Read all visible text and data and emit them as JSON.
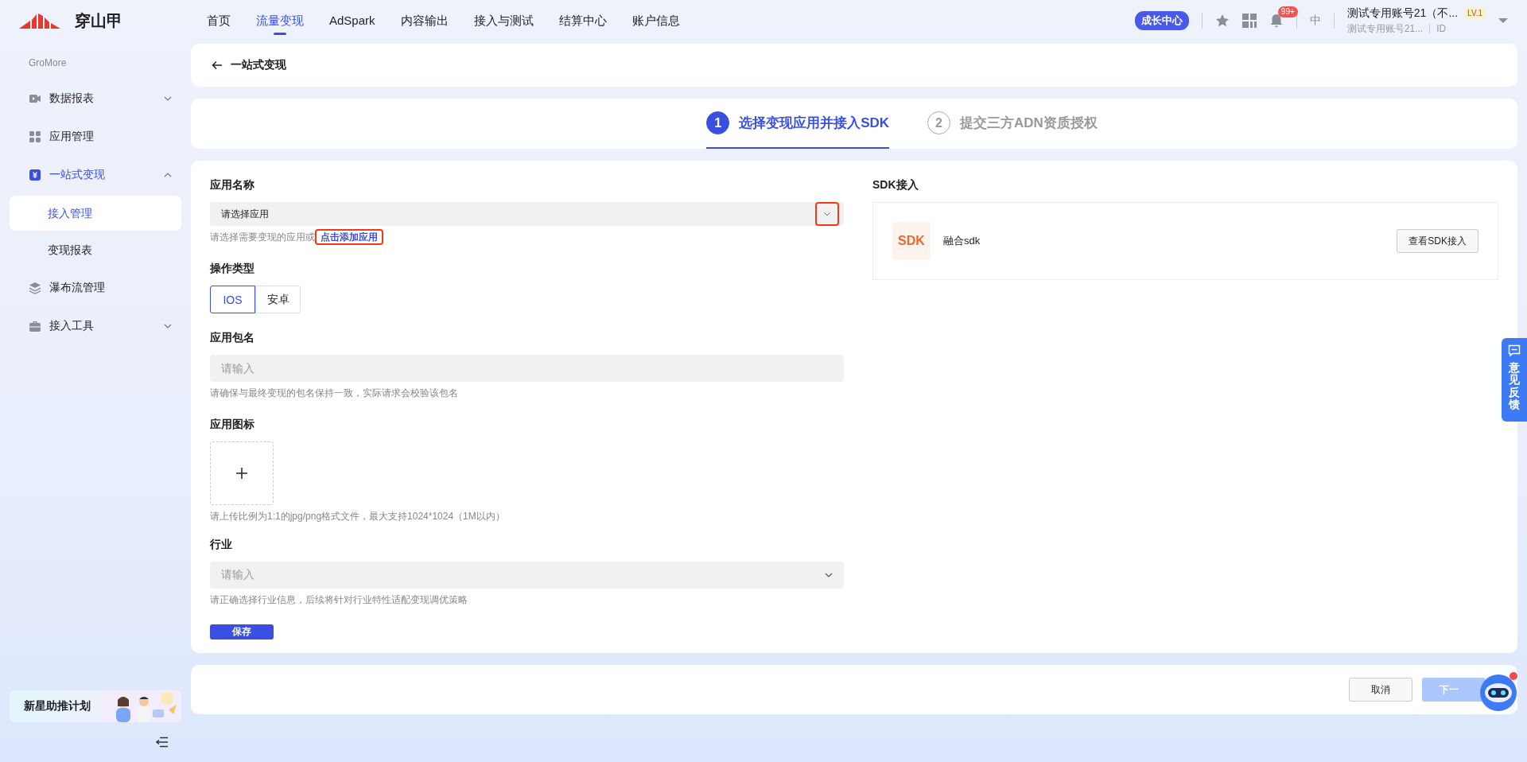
{
  "logo": {
    "text": "穿山甲"
  },
  "nav": [
    {
      "label": "首页",
      "selected": false
    },
    {
      "label": "流量变现",
      "selected": true
    },
    {
      "label": "AdSpark",
      "selected": false
    },
    {
      "label": "内容输出",
      "selected": false
    },
    {
      "label": "接入与测试",
      "selected": false
    },
    {
      "label": "结算中心",
      "selected": false
    },
    {
      "label": "账户信息",
      "selected": false
    }
  ],
  "header_right": {
    "growth_badge": "成长中心",
    "notification_count": "99+",
    "language": "中",
    "account_name": "测试专用账号21（不...",
    "level": "LV.1",
    "account_sub": "测试专用账号21...",
    "id_label": "ID"
  },
  "sidebar": {
    "section": "GroMore",
    "items": [
      {
        "label": "数据报表",
        "expanded": false,
        "selected": false
      },
      {
        "label": "应用管理",
        "selected": false
      },
      {
        "label": "一站式变现",
        "expanded": true,
        "selected": true,
        "children": [
          {
            "label": "接入管理",
            "selected": true
          },
          {
            "label": "变现报表",
            "selected": false
          }
        ]
      },
      {
        "label": "瀑布流管理",
        "selected": false
      },
      {
        "label": "接入工具",
        "expanded": false,
        "selected": false
      }
    ],
    "banner": "新星助推计划"
  },
  "page_title": "一站式变现",
  "steps": [
    {
      "number": "1",
      "label": "选择变现应用并接入SDK",
      "selected": true
    },
    {
      "number": "2",
      "label": "提交三方ADN资质授权",
      "selected": false
    }
  ],
  "form": {
    "fields": [
      {
        "kind": "select",
        "label": "应用名称",
        "value": "请选择应用",
        "arrow_highlighted": true,
        "help": "请选择需要变现的应用或",
        "help_link": "点击添加应用",
        "link_highlighted": true
      },
      {
        "kind": "segmented",
        "label": "操作类型",
        "options": [
          {
            "label": "IOS",
            "selected": true
          },
          {
            "label": "安卓",
            "selected": false
          }
        ]
      },
      {
        "kind": "input",
        "label": "应用包名",
        "placeholder": "请输入",
        "help": "请确保与最终变现的包名保持一致，实际请求会校验该包名"
      },
      {
        "kind": "upload",
        "label": "应用图标",
        "help": "请上传比例为1:1的jpg/png格式文件，最大支持1024*1024（1M以内）"
      },
      {
        "kind": "dropdown",
        "label": "行业",
        "placeholder": "请输入",
        "help": "请正确选择行业信息，后续将针对行业特性适配变现调优策略"
      }
    ],
    "save_button": "保存"
  },
  "sdk": {
    "title": "SDK接入",
    "logo_text": "SDK",
    "name": "融合sdk",
    "button": "查看SDK接入"
  },
  "feedback": "意见反馈",
  "footer": {
    "cancel": "取消",
    "next": "下一",
    "next_disabled": true
  }
}
